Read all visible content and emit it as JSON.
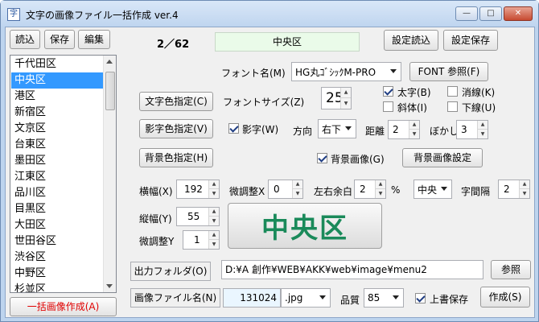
{
  "window": {
    "title": "文字の画像ファイル一括作成 ver.4",
    "icon_char": "字",
    "minimize_glyph": "—",
    "maximize_glyph": "□",
    "close_glyph": "✕"
  },
  "toolbar": {
    "load_label": "読込",
    "save_label": "保存",
    "edit_label": "編集"
  },
  "counter": {
    "text": "2／62"
  },
  "current_name": "中央区",
  "settings_buttons": {
    "load_settings": "設定読込",
    "save_settings": "設定保存"
  },
  "list": {
    "items": [
      "千代田区",
      "中央区",
      "港区",
      "新宿区",
      "文京区",
      "台東区",
      "墨田区",
      "江東区",
      "品川区",
      "目黒区",
      "大田区",
      "世田谷区",
      "渋谷区",
      "中野区",
      "杉並区"
    ],
    "selected_index": 1
  },
  "batch_button": "一括画像作成(A)",
  "font": {
    "name_label": "フォント名(M)",
    "name_value": "HG丸ｺﾞｼｯｸM-PRO",
    "ref_button": "FONT 参照(F)",
    "size_label": "フォントサイズ(Z)",
    "size_value": "25",
    "bold_label": "太字(B)",
    "bold_checked": true,
    "strike_label": "消線(K)",
    "strike_checked": false,
    "italic_label": "斜体(I)",
    "italic_checked": false,
    "underline_label": "下線(U)",
    "underline_checked": false
  },
  "color_buttons": {
    "text_color": "文字色指定(C)",
    "shadow_color": "影字色指定(V)",
    "bg_color": "背景色指定(H)"
  },
  "shadow": {
    "label": "影字(W)",
    "checked": true,
    "direction_label": "方向",
    "direction_value": "右下",
    "distance_label": "距離",
    "distance_value": "2",
    "blur_label": "ぼかし",
    "blur_value": "3"
  },
  "background": {
    "image_label": "背景画像(G)",
    "image_checked": true,
    "settings_button": "背景画像設定"
  },
  "size": {
    "width_label": "横幅(X)",
    "width_value": "192",
    "fine_x_label": "微調整X",
    "fine_x_value": "0",
    "margin_label": "左右余白",
    "margin_value": "2",
    "percent_sign": "%",
    "align_value": "中央",
    "spacing_label": "字間隔",
    "spacing_value": "2",
    "height_label": "縦幅(Y)",
    "height_value": "55",
    "fine_y_label": "微調整Y",
    "fine_y_value": "1"
  },
  "preview": {
    "text": "中央区",
    "color": "#1a8a5a"
  },
  "output": {
    "folder_label": "出力フォルダ(O)",
    "folder_value": "D:¥A 創作¥WEB¥AKK¥web¥image¥menu2",
    "ref_button": "参照",
    "file_label": "画像ファイル名(N)",
    "file_value": "131024",
    "ext_value": ".jpg",
    "quality_label": "品質",
    "quality_value": "85",
    "overwrite_label": "上書保存",
    "overwrite_checked": true,
    "create_button": "作成(S)"
  },
  "colors": {
    "selection": "#3399ff",
    "batch_text": "#e00000",
    "name_field_bg": "#eafbe9"
  }
}
